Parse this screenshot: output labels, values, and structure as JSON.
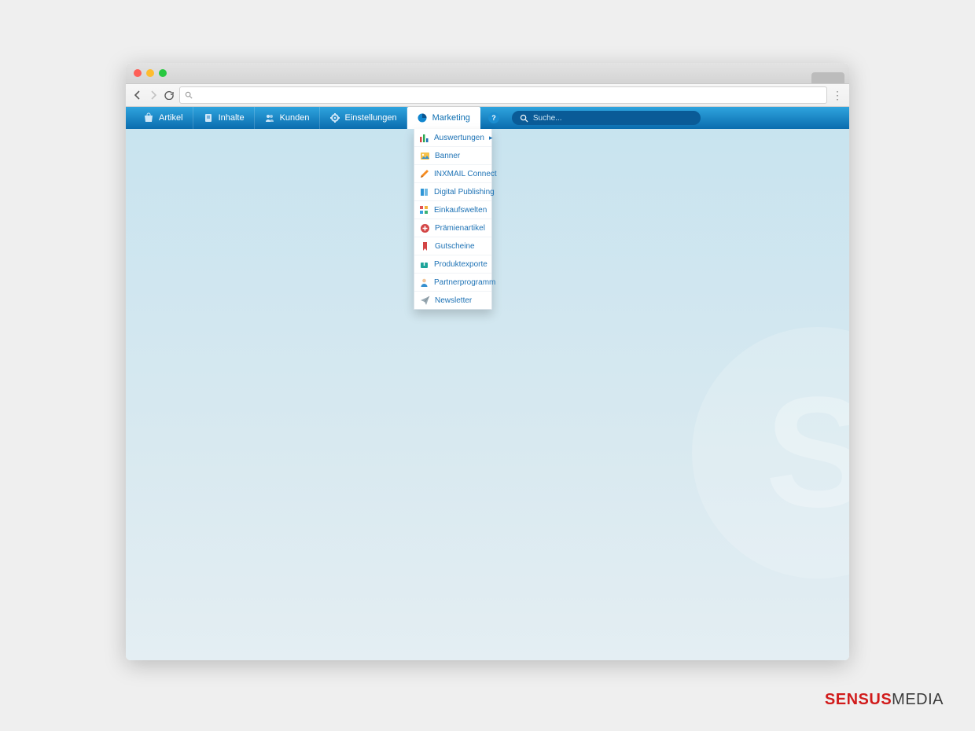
{
  "browser": {
    "address": ""
  },
  "navbar": {
    "items": [
      {
        "label": "Artikel"
      },
      {
        "label": "Inhalte"
      },
      {
        "label": "Kunden"
      },
      {
        "label": "Einstellungen"
      },
      {
        "label": "Marketing"
      }
    ],
    "search_placeholder": "Suche..."
  },
  "dropdown": {
    "items": [
      {
        "label": "Auswertungen",
        "has_sub": true
      },
      {
        "label": "Banner"
      },
      {
        "label": "INXMAIL Connect"
      },
      {
        "label": "Digital Publishing"
      },
      {
        "label": "Einkaufswelten"
      },
      {
        "label": "Prämienartikel"
      },
      {
        "label": "Gutscheine"
      },
      {
        "label": "Produktexporte"
      },
      {
        "label": "Partnerprogramm"
      },
      {
        "label": "Newsletter"
      }
    ]
  },
  "brand": {
    "part1": "SENSUS",
    "part2": "MEDIA"
  }
}
